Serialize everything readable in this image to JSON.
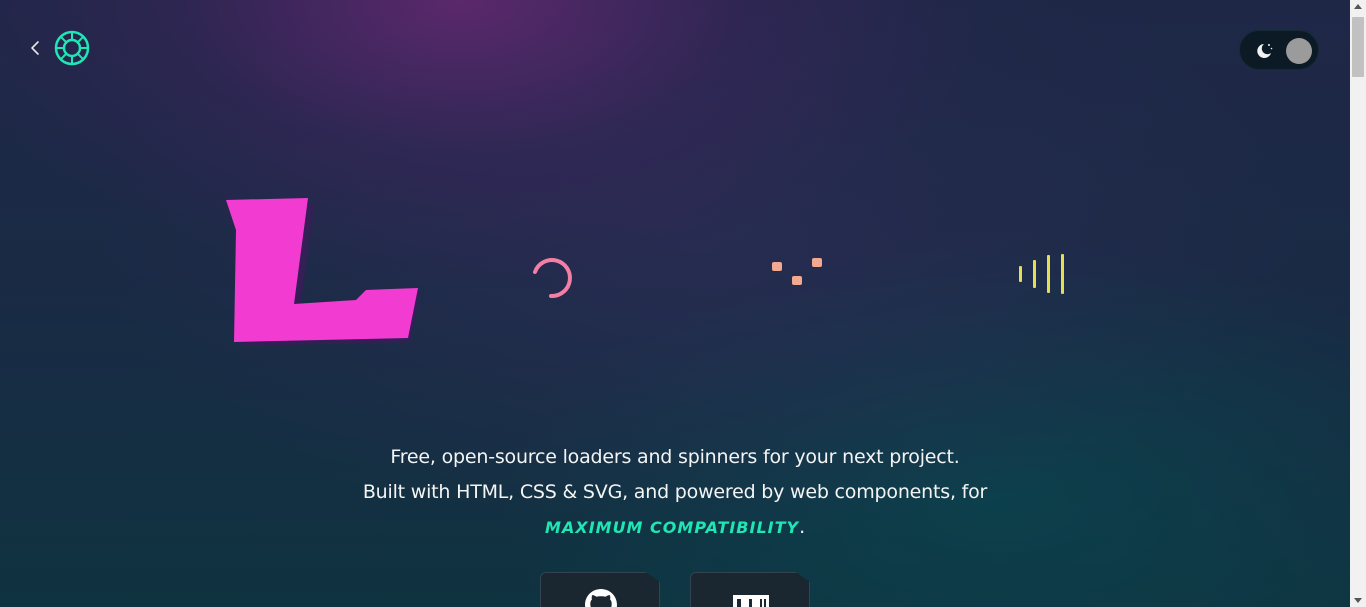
{
  "header": {
    "back_icon": "chevron-left-icon",
    "logo_icon": "ring-logo-icon",
    "theme_toggle_icon": "moon-stars-icon"
  },
  "hero": {
    "logo_letter": "L",
    "tagline_line1": "Free, open-source loaders and spinners for your next project.",
    "tagline_line2": "Built with HTML, CSS & SVG, and powered by web components, for",
    "highlight": "maximum compatibility",
    "period": "."
  },
  "buttons": {
    "github_icon": "github-icon",
    "npm_icon": "npm-icon"
  },
  "colors": {
    "accent": "#1fe6b4",
    "logo_pink": "#f23bd0",
    "spinner_pink": "#f47fa6",
    "dots_peach": "#f3a890",
    "bars_yellow": "#e5de54"
  }
}
